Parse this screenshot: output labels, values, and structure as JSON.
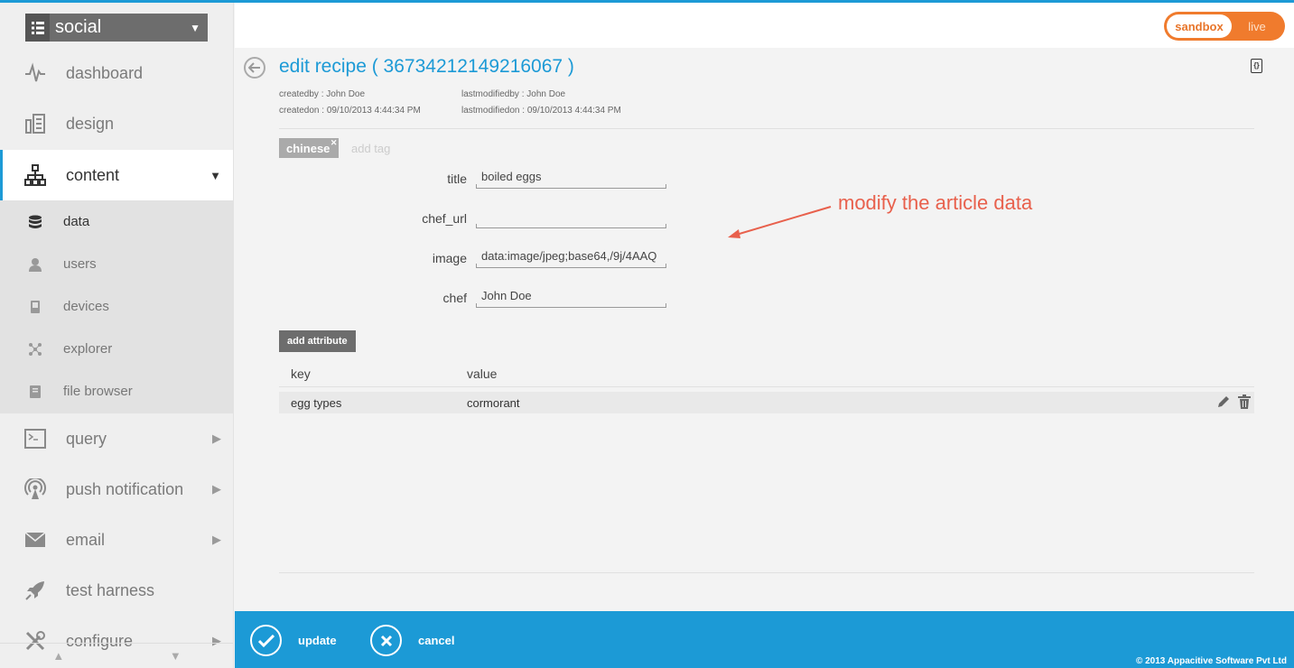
{
  "sidebar": {
    "app_name": "social",
    "items": [
      {
        "label": "dashboard",
        "icon": "pulse-icon"
      },
      {
        "label": "design",
        "icon": "design-icon"
      },
      {
        "label": "content",
        "icon": "sitemap-icon"
      }
    ],
    "sub_items": [
      {
        "label": "data",
        "icon": "database-icon"
      },
      {
        "label": "users",
        "icon": "user-icon"
      },
      {
        "label": "devices",
        "icon": "device-icon"
      },
      {
        "label": "explorer",
        "icon": "graph-icon"
      },
      {
        "label": "file browser",
        "icon": "file-icon"
      }
    ],
    "items_below": [
      {
        "label": "query",
        "icon": "terminal-icon"
      },
      {
        "label": "push notification",
        "icon": "broadcast-icon"
      },
      {
        "label": "email",
        "icon": "envelope-icon"
      },
      {
        "label": "test harness",
        "icon": "rocket-icon"
      },
      {
        "label": "configure",
        "icon": "tools-icon"
      }
    ]
  },
  "header": {
    "env_active": "sandbox",
    "env_inactive": "live"
  },
  "main": {
    "title": "edit recipe ( 36734212149216067 )",
    "meta": {
      "createdby": "createdby : John Doe",
      "createdon": "createdon : 09/10/2013 4:44:34 PM",
      "lastmodifiedby": "lastmodifiedby : John Doe",
      "lastmodifiedon": "lastmodifiedon : 09/10/2013 4:44:34 PM"
    },
    "tag": "chinese",
    "add_tag_placeholder": "add tag",
    "fields": [
      {
        "label": "title",
        "value": "boiled eggs"
      },
      {
        "label": "chef_url",
        "value": ""
      },
      {
        "label": "image",
        "value": "data:image/jpeg;base64,/9j/4AAQ"
      },
      {
        "label": "chef",
        "value": "John Doe"
      }
    ],
    "annotation": "modify the article data",
    "annotation_color": "#e8604c",
    "add_attribute_label": "add attribute",
    "table": {
      "headers": [
        "key",
        "value"
      ],
      "rows": [
        {
          "key": "egg types",
          "value": "cormorant"
        }
      ]
    }
  },
  "footer": {
    "update_label": "update",
    "cancel_label": "cancel",
    "copyright": "© 2013 Appacitive Software Pvt Ltd"
  },
  "colors": {
    "accent": "#1c9ad6",
    "toggle": "#f07b2d"
  }
}
